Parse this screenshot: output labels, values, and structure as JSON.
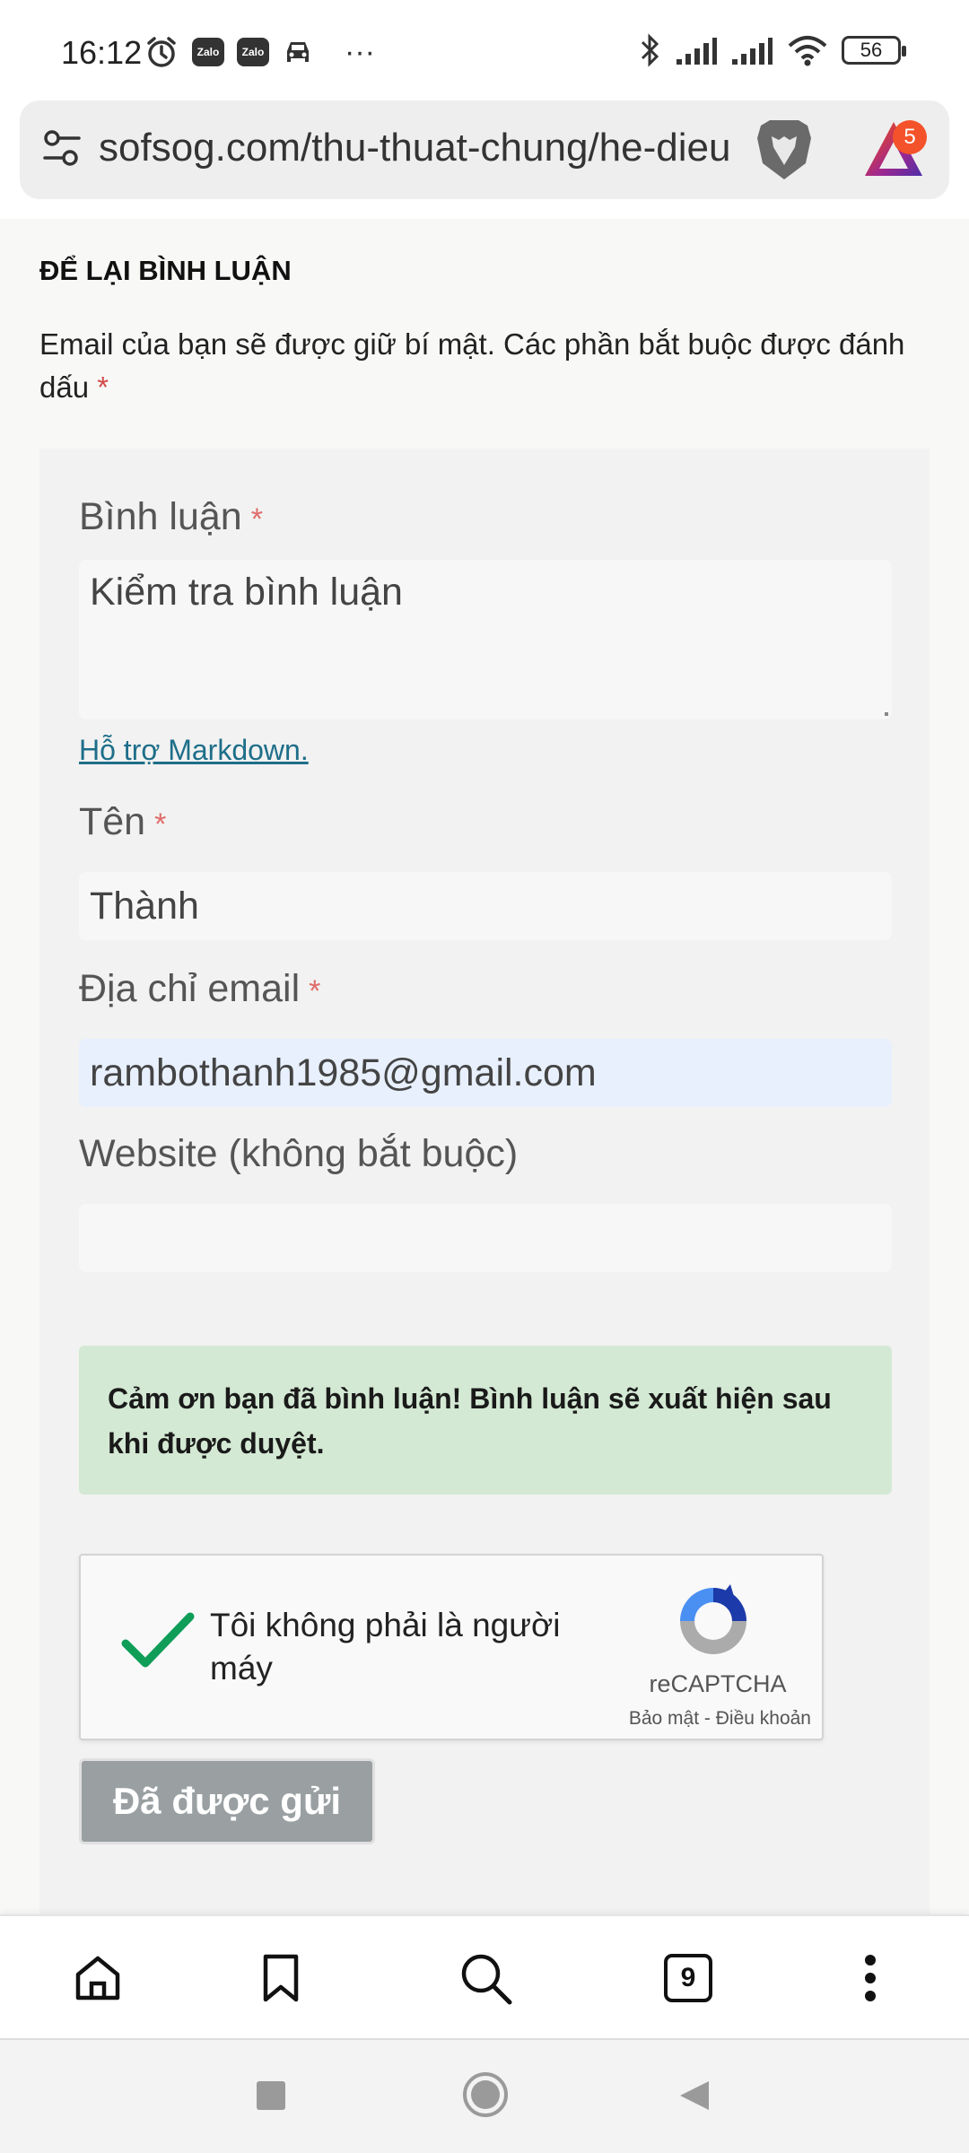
{
  "status_bar": {
    "time": "16:12",
    "zalo_label": "Zalo",
    "more": "···",
    "battery": "56"
  },
  "browser": {
    "url": "sofsog.com/thu-thuat-chung/he-dieu",
    "rewards_badge": "5"
  },
  "comment_section": {
    "title": "ĐỂ LẠI BÌNH LUẬN",
    "notes": "Email của bạn sẽ được giữ bí mật. Các phần bắt buộc được đánh dấu",
    "required_mark": "*"
  },
  "form": {
    "comment_label": "Bình luận",
    "comment_value": "Kiểm tra bình luận",
    "markdown_link": "Hỗ trợ Markdown.",
    "name_label": "Tên",
    "name_value": "Thành",
    "email_label": "Địa chỉ email",
    "email_value": "rambothanh1985@gmail.com",
    "website_label": "Website (không bắt buộc)",
    "website_value": "",
    "success_message": "Cảm ơn bạn đã bình luận! Bình luận sẽ xuất hiện sau khi được duyệt.",
    "submit_label": "Đã được gửi"
  },
  "recaptcha": {
    "label": "Tôi không phải là người máy",
    "brand": "reCAPTCHA",
    "privacy": "Bảo mật",
    "separator": "-",
    "terms": "Điều khoản",
    "checked": true
  },
  "toolbar": {
    "tab_count": "9"
  },
  "colors": {
    "success_bg": "#d4e9d4",
    "required_star": "#e06b6b",
    "link": "#1e6e8a",
    "submit_bg": "#9aa0a2",
    "checkmark": "#0f9d58"
  }
}
